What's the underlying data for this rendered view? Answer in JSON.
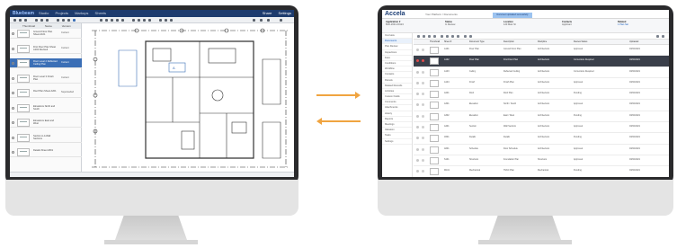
{
  "left_app": {
    "brand": "Bluebeam",
    "tabs": [
      "Studio",
      "Projects",
      "Markups",
      "Sheets"
    ],
    "right_items": [
      "Share",
      "Settings"
    ],
    "columns": [
      "Thumbnail",
      "Name",
      "Version"
    ],
    "sheets": [
      {
        "name": "Ground Floor Plan Sheet A101",
        "version": "Current"
      },
      {
        "name": "First Floor Plan Sheet A102 Revised",
        "version": "Current"
      },
      {
        "name": "Floor Level 2 Reflected Ceiling Plan",
        "version": "Current"
      },
      {
        "name": "Floor Level 3 Finish Plan",
        "version": "Current"
      },
      {
        "name": "Roof Plan Sheet A201",
        "version": "Superseded"
      },
      {
        "name": "Elevations North and South",
        "version": ""
      },
      {
        "name": "Elevations East and West",
        "version": ""
      },
      {
        "name": "Section A-A Wall Sections",
        "version": ""
      },
      {
        "name": "Details Sheet A501",
        "version": ""
      }
    ]
  },
  "right_app": {
    "brand": "Accela",
    "breadcrumb": "Your Platform / Documents",
    "banner": "Document uploaded successfully",
    "info": [
      {
        "label": "Application #",
        "value": "BLD-2021-00124"
      },
      {
        "label": "Status",
        "value": "In Review"
      },
      {
        "label": "Location",
        "value": "123 Main St"
      },
      {
        "label": "Contacts",
        "value": "Applicant"
      },
      {
        "label": "Related",
        "value": "1 Plan Set"
      }
    ],
    "nav": [
      "Overview",
      "Documents",
      "Plan Review",
      "Inspections",
      "Fees",
      "Conditions",
      "Workflow",
      "Contacts",
      "Parcels",
      "Related Records",
      "Activities",
      "Custom Fields",
      "Comments",
      "Attachments",
      "History",
      "Reports",
      "Meetings",
      "Valuation",
      "Tasks",
      "Settings"
    ],
    "grid_columns": [
      "",
      "Thumbnail",
      "Sheet #",
      "Document Type",
      "Description",
      "Discipline",
      "Review Status",
      "Uploaded"
    ],
    "rows": [
      {
        "sheet": "A101",
        "type": "Floor Plan",
        "desc": "Ground Floor Plan",
        "disc": "Architectural",
        "status": "Approved",
        "date": "03/02/2021"
      },
      {
        "sheet": "A102",
        "type": "Floor Plan",
        "desc": "First Floor Plan",
        "disc": "Architectural",
        "status": "Corrections Required",
        "date": "03/02/2021"
      },
      {
        "sheet": "A103",
        "type": "Ceiling",
        "desc": "Reflected Ceiling",
        "disc": "Architectural",
        "status": "Corrections Required",
        "date": "03/02/2021"
      },
      {
        "sheet": "A104",
        "type": "Finish",
        "desc": "Finish Plan",
        "disc": "Architectural",
        "status": "Approved",
        "date": "03/02/2021"
      },
      {
        "sheet": "A201",
        "type": "Roof",
        "desc": "Roof Plan",
        "disc": "Architectural",
        "status": "Pending",
        "date": "03/02/2021"
      },
      {
        "sheet": "A301",
        "type": "Elevation",
        "desc": "North / South",
        "disc": "Architectural",
        "status": "Approved",
        "date": "03/02/2021"
      },
      {
        "sheet": "A302",
        "type": "Elevation",
        "desc": "East / West",
        "disc": "Architectural",
        "status": "Pending",
        "date": "03/02/2021"
      },
      {
        "sheet": "A401",
        "type": "Section",
        "desc": "Wall Sections",
        "disc": "Architectural",
        "status": "Approved",
        "date": "03/02/2021"
      },
      {
        "sheet": "A501",
        "type": "Details",
        "desc": "Details",
        "disc": "Architectural",
        "status": "Pending",
        "date": "03/02/2021"
      },
      {
        "sheet": "A601",
        "type": "Schedule",
        "desc": "Door Schedule",
        "disc": "Architectural",
        "status": "Approved",
        "date": "03/02/2021"
      },
      {
        "sheet": "S101",
        "type": "Structural",
        "desc": "Foundation Plan",
        "disc": "Structural",
        "status": "Approved",
        "date": "03/02/2021"
      },
      {
        "sheet": "M101",
        "type": "Mechanical",
        "desc": "HVAC Plan",
        "disc": "Mechanical",
        "status": "Pending",
        "date": "03/02/2021"
      }
    ]
  },
  "colors": {
    "arrow": "#f0a440",
    "left_header": "#1d3b6e",
    "selection": "#3b6fb6",
    "right_selection": "#3a3f4a",
    "bezel": "#2a2a2c"
  }
}
